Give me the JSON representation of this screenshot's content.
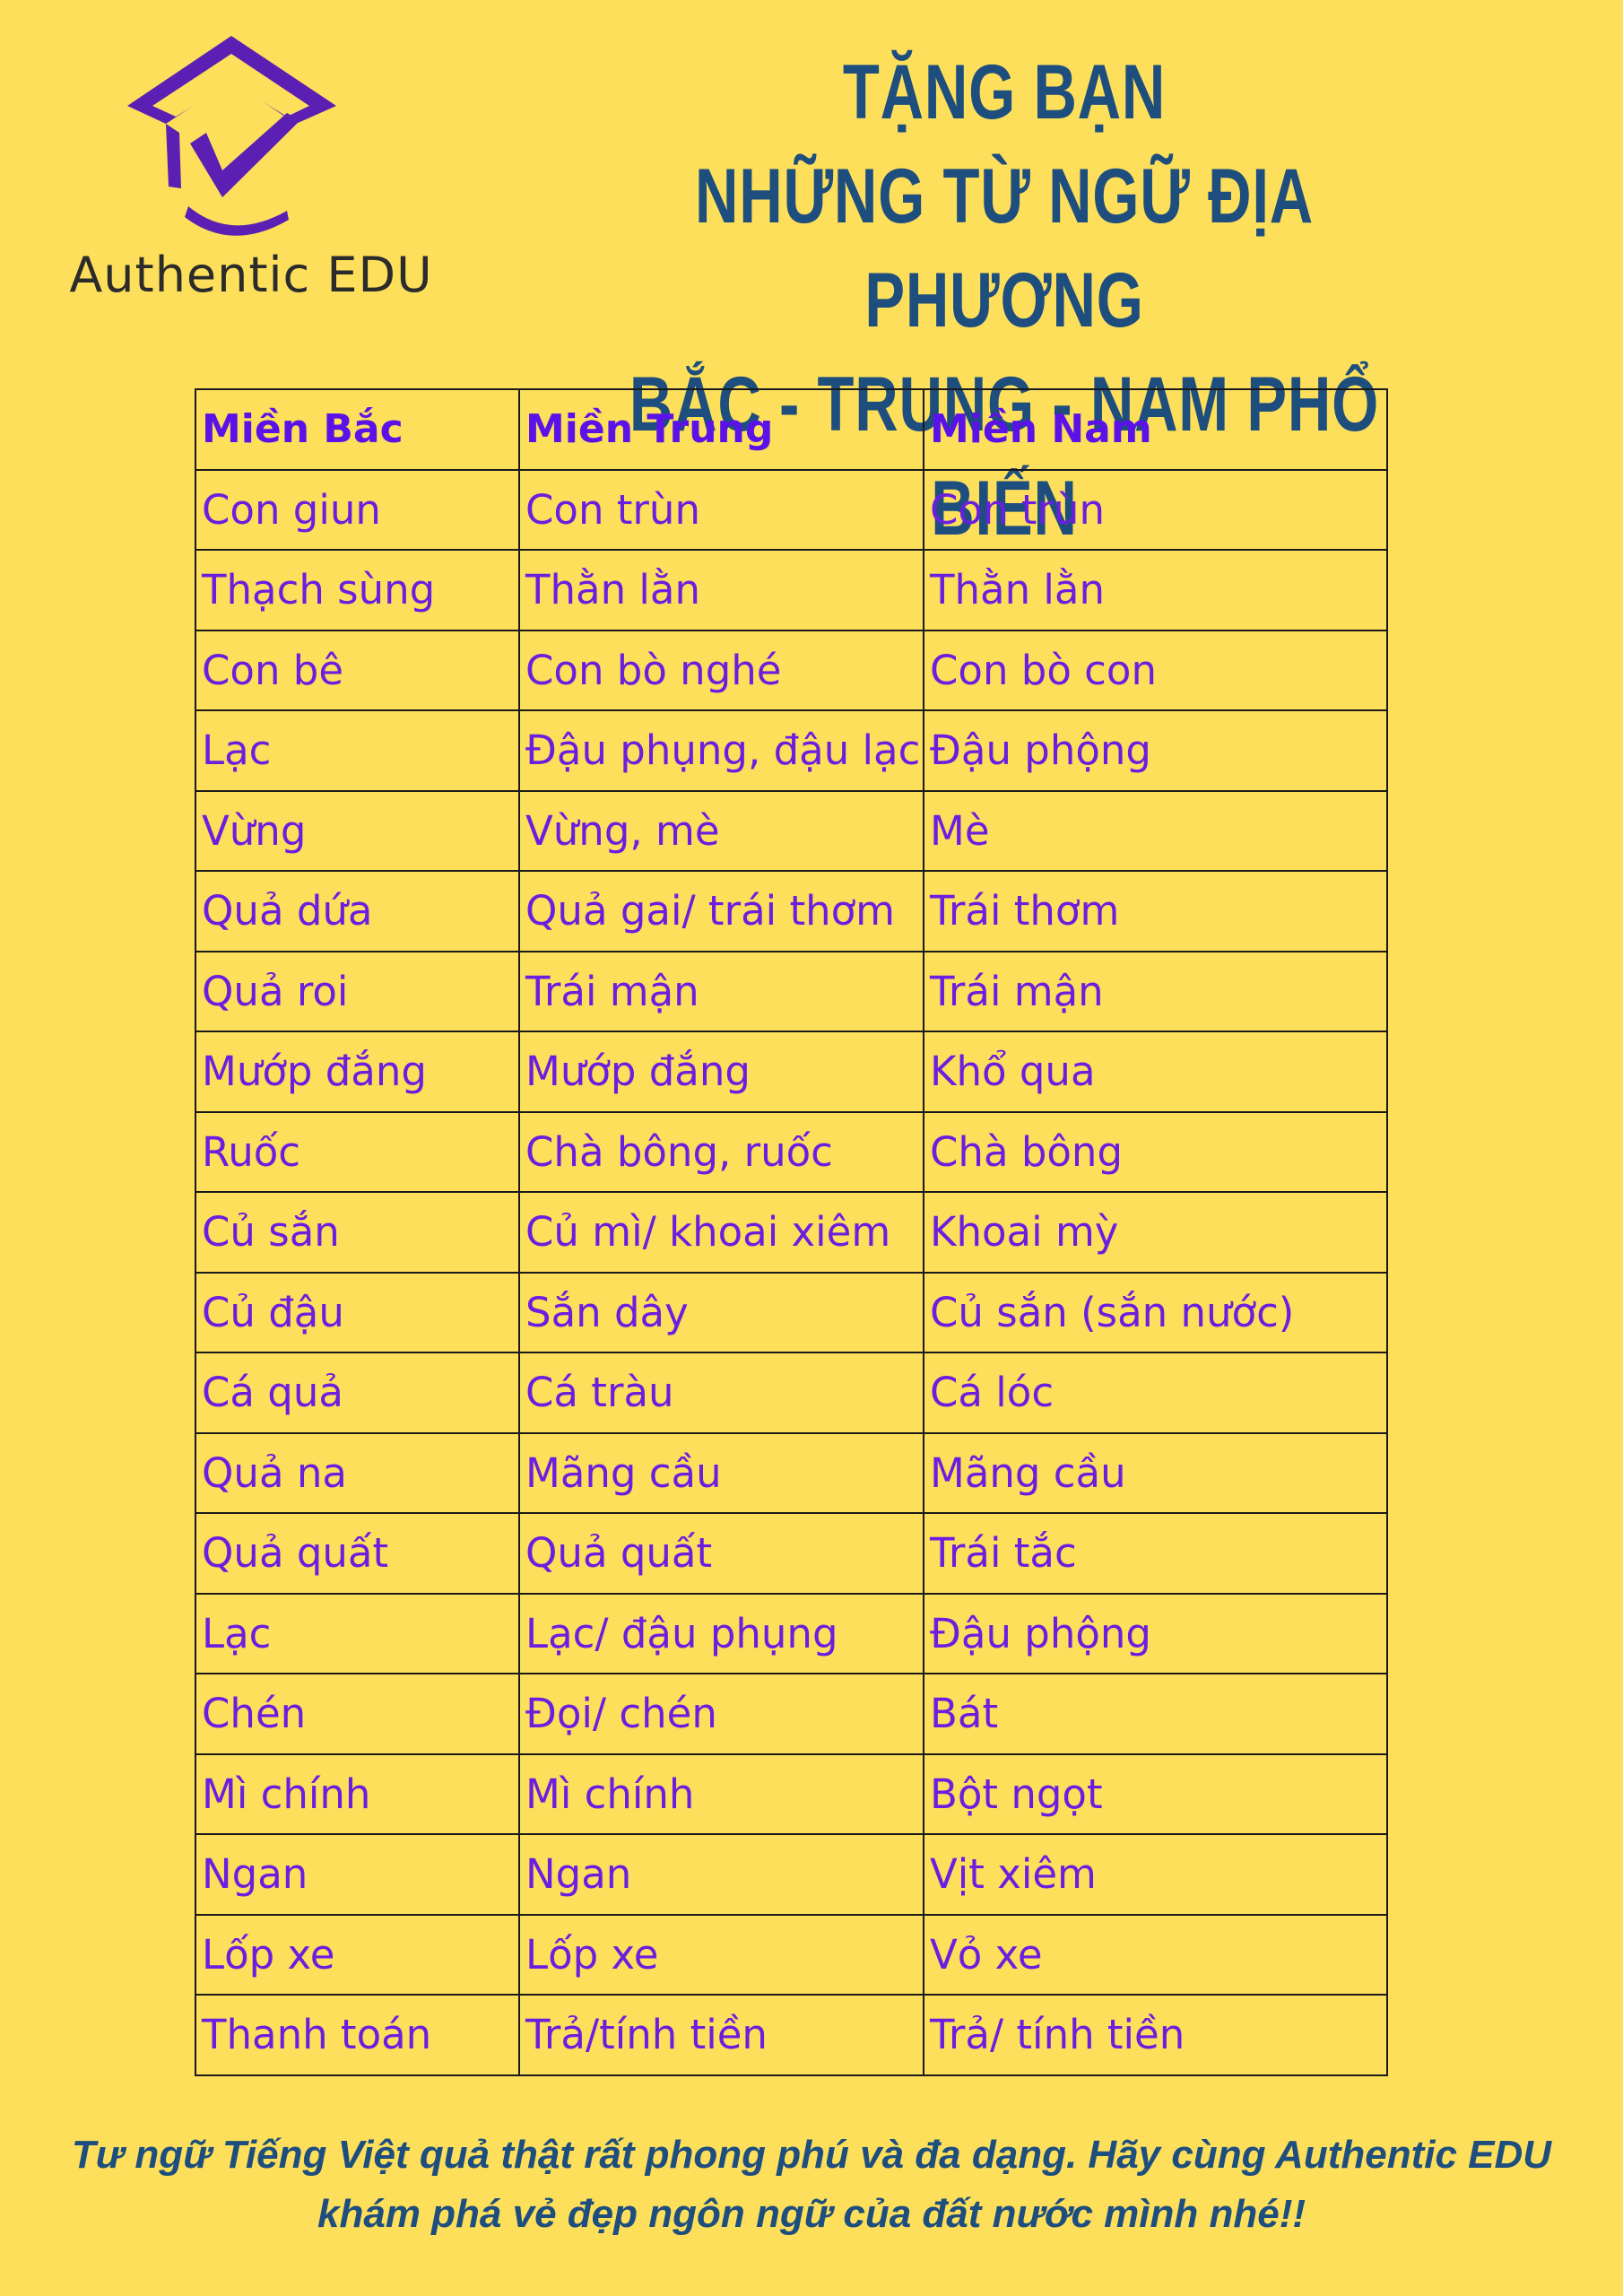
{
  "brand": {
    "logo_text": "Authentic EDU",
    "logo_color": "#5b1fb4"
  },
  "title": {
    "line1": "TẶNG BẠN",
    "line2": "NHỮNG TỪ NGỮ ĐỊA PHƯƠNG",
    "line3": "BẮC - TRUNG - NAM PHỔ BIẾN"
  },
  "table": {
    "headers": [
      "Miền Bắc",
      "Miền  Trung",
      "Miền Nam"
    ],
    "rows": [
      [
        "Con giun",
        "Con trùn",
        "Con trùn"
      ],
      [
        "Thạch sùng",
        "Thằn lằn",
        "Thằn lằn"
      ],
      [
        "Con bê",
        "Con bò nghé",
        "Con bò con"
      ],
      [
        "Lạc",
        "Đậu phụng, đậu lạc",
        "Đậu phộng"
      ],
      [
        "Vừng",
        "Vừng, mè",
        "Mè"
      ],
      [
        "Quả dứa",
        "Quả gai/ trái thơm",
        "Trái thơm"
      ],
      [
        "Quả roi",
        "Trái mận",
        "Trái mận"
      ],
      [
        "Mướp đắng",
        "Mướp đắng",
        "Khổ qua"
      ],
      [
        "Ruốc",
        "Chà bông, ruốc",
        "Chà bông"
      ],
      [
        "Củ sắn",
        "Củ mì/ khoai xiêm",
        "Khoai mỳ"
      ],
      [
        "Củ đậu",
        "Sắn dây",
        "Củ sắn (sắn nước)"
      ],
      [
        "Cá quả",
        "Cá tràu",
        "Cá lóc"
      ],
      [
        "Quả na",
        "Mãng cầu",
        "Mãng cầu"
      ],
      [
        "Quả quất",
        "Quả quất",
        "Trái tắc"
      ],
      [
        "Lạc",
        "Lạc/ đậu phụng",
        "Đậu phộng"
      ],
      [
        "Chén",
        "Đọi/ chén",
        "Bát"
      ],
      [
        "Mì chính",
        "Mì chính",
        "Bột ngọt"
      ],
      [
        "Ngan",
        "Ngan",
        "Vịt xiêm"
      ],
      [
        "Lốp xe",
        "Lốp xe",
        "Vỏ xe"
      ],
      [
        "Thanh toán",
        "Trả/tính tiền",
        "Trả/ tính tiền"
      ]
    ]
  },
  "footer": {
    "line1": "Tư ngữ Tiếng Việt quả thật rất phong phú và đa dạng. Hãy cùng Authentic EDU",
    "line2": "khám phá vẻ đẹp ngôn ngữ của đất nước mình nhé!!"
  },
  "colors": {
    "background": "#FDDF5B",
    "title": "#1d4e7e",
    "table_text": "#6a1fe0",
    "grid": "#1a1a1a"
  }
}
